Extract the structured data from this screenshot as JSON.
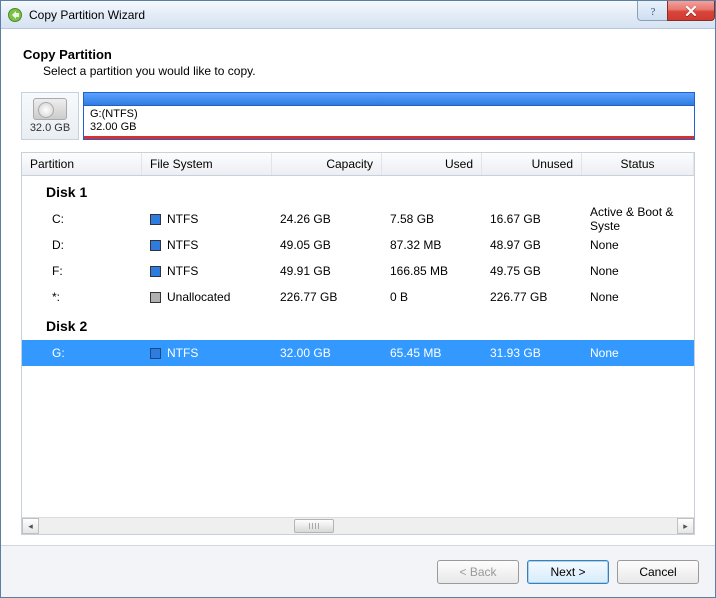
{
  "window": {
    "title": "Copy Partition Wizard"
  },
  "header": {
    "title": "Copy Partition",
    "subtitle": "Select a partition you would like to copy."
  },
  "disk_visual": {
    "size_label": "32.0 GB",
    "partition_label": "G:(NTFS)",
    "partition_size": "32.00 GB"
  },
  "columns": {
    "partition": "Partition",
    "filesystem": "File System",
    "capacity": "Capacity",
    "used": "Used",
    "unused": "Unused",
    "status": "Status"
  },
  "groups": {
    "disk1": "Disk 1",
    "disk2": "Disk 2"
  },
  "rows": {
    "c": {
      "part": "C:",
      "fs": "NTFS",
      "swatch": "blue",
      "cap": "24.26 GB",
      "used": "7.58 GB",
      "unused": "16.67 GB",
      "status": "Active & Boot & Syste"
    },
    "d": {
      "part": "D:",
      "fs": "NTFS",
      "swatch": "blue",
      "cap": "49.05 GB",
      "used": "87.32 MB",
      "unused": "48.97 GB",
      "status": "None"
    },
    "f": {
      "part": "F:",
      "fs": "NTFS",
      "swatch": "blue",
      "cap": "49.91 GB",
      "used": "166.85 MB",
      "unused": "49.75 GB",
      "status": "None"
    },
    "un": {
      "part": "*:",
      "fs": "Unallocated",
      "swatch": "gray",
      "cap": "226.77 GB",
      "used": "0 B",
      "unused": "226.77 GB",
      "status": "None"
    },
    "g": {
      "part": "G:",
      "fs": "NTFS",
      "swatch": "blue",
      "cap": "32.00 GB",
      "used": "65.45 MB",
      "unused": "31.93 GB",
      "status": "None"
    }
  },
  "footer": {
    "back": "< Back",
    "next": "Next >",
    "cancel": "Cancel"
  }
}
